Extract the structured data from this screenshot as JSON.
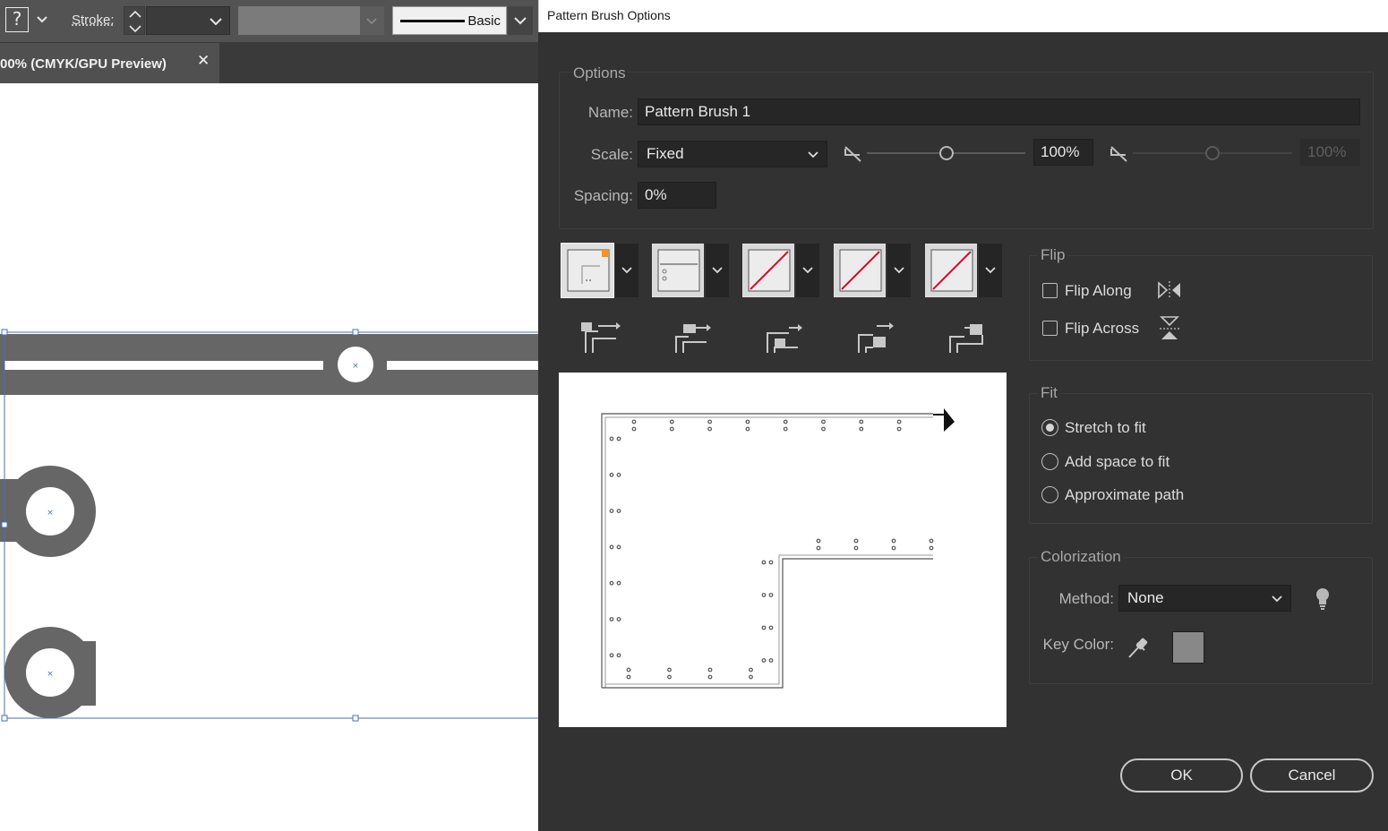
{
  "toolbar": {
    "help_glyph": "?",
    "stroke_label": "Stroke:",
    "brush_style_label": "Basic"
  },
  "document_tab": {
    "title": "00% (CMYK/GPU Preview)",
    "close_glyph": "✕"
  },
  "dialog": {
    "title": "Pattern Brush Options",
    "options_group": {
      "title": "Options",
      "name_label": "Name:",
      "name_value": "Pattern Brush 1",
      "scale_label": "Scale:",
      "scale_value": "Fixed",
      "scale_percent": "100%",
      "scale_percent_disabled": "100%",
      "scale_slider_level": 0.5,
      "spacing_label": "Spacing:",
      "spacing_value": "0%"
    },
    "tiles": [
      {
        "name": "outer-corner",
        "selected": true
      },
      {
        "name": "side"
      },
      {
        "name": "inner-corner"
      },
      {
        "name": "start"
      },
      {
        "name": "end"
      }
    ],
    "flip_group": {
      "title": "Flip",
      "flip_along_label": "Flip Along",
      "flip_along_checked": false,
      "flip_across_label": "Flip Across",
      "flip_across_checked": false
    },
    "fit_group": {
      "title": "Fit",
      "options": [
        "Stretch to fit",
        "Add space to fit",
        "Approximate path"
      ],
      "selected": "Stretch to fit"
    },
    "colorization_group": {
      "title": "Colorization",
      "method_label": "Method:",
      "method_value": "None",
      "key_color_label": "Key Color:",
      "key_color": "#888888"
    },
    "buttons": {
      "ok": "OK",
      "cancel": "Cancel"
    }
  },
  "colors": {
    "dialog_bg": "#323232",
    "artwork_gray": "#666666",
    "selection_blue": "#4a6fb5",
    "tile_slash_red": "#d0112b",
    "swatch_accent_orange": "#f7931e"
  }
}
